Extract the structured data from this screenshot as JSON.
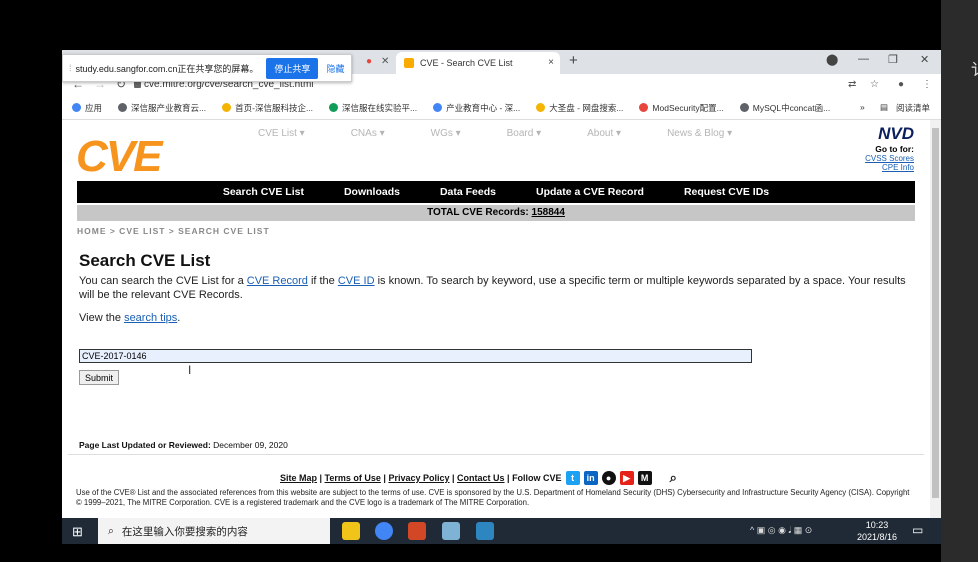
{
  "share_bar": {
    "text": "study.edu.sangfor.com.cn正在共享您的屏幕。",
    "stop": "停止共享",
    "hide": "隐藏"
  },
  "tab": {
    "title": "CVE - Search CVE List",
    "close": "×",
    "new": "+"
  },
  "address": {
    "url": "cve.mitre.org/cve/search_cve_list.html"
  },
  "bookmarks": [
    {
      "label": "应用",
      "color": "#4285f4"
    },
    {
      "label": "深信服产业教育云...",
      "color": "#5f6368"
    },
    {
      "label": "首页-深信服科技企...",
      "color": "#f4b400"
    },
    {
      "label": "深信服在线实验平...",
      "color": "#0f9d58"
    },
    {
      "label": "产业教育中心 - 深...",
      "color": "#4285f4"
    },
    {
      "label": "大圣盘 - 网盘搜索...",
      "color": "#f4b400"
    },
    {
      "label": "ModSecurity配置...",
      "color": "#e8453c"
    },
    {
      "label": "MySQL中concat函...",
      "color": "#5f6368"
    }
  ],
  "bookmarks_more": "»",
  "reading_list": "阅读清单",
  "site": {
    "logo": "CVE",
    "topnav": [
      "CVE List ▾",
      "CNAs ▾",
      "WGs ▾",
      "Board ▾",
      "About ▾",
      "News & Blog ▾"
    ],
    "nvd": {
      "logo": "NVD",
      "goto": "Go to for:",
      "link1": "CVSS Scores",
      "link2": "CPE Info"
    },
    "mainnav": [
      "Search CVE List",
      "Downloads",
      "Data Feeds",
      "Update a CVE Record",
      "Request CVE IDs"
    ],
    "total_label": "TOTAL CVE Records:",
    "total_value": "158844",
    "breadcrumb": "HOME > CVE LIST > SEARCH CVE LIST",
    "heading": "Search CVE List",
    "intro_1": "You can search the CVE List for a ",
    "intro_link1": "CVE Record",
    "intro_2": " if the ",
    "intro_link2": "CVE ID",
    "intro_3": " is known. To search by keyword, use a specific term or multiple keywords separated by a space. Your results will be the relevant CVE Records.",
    "view_1": "View the ",
    "view_link": "search tips",
    "view_2": ".",
    "search_value": "CVE-2017-0146",
    "submit": "Submit",
    "updated_label": "Page Last Updated or Reviewed:",
    "updated_value": "December 09, 2020",
    "foot_sitemap": "Site Map",
    "foot_terms": "Terms of Use",
    "foot_privacy": "Privacy Policy",
    "foot_contact": "Contact Us",
    "foot_follow": "Follow CVE",
    "legal": "Use of the CVE® List and the associated references from this website are subject to the terms of use. CVE is sponsored by the U.S. Department of Homeland Security (DHS) Cybersecurity and Infrastructure Security Agency (CISA). Copyright © 1999–2021, The MITRE Corporation. CVE is a registered trademark and the CVE logo is a trademark of The MITRE Corporation."
  },
  "taskbar": {
    "search_placeholder": "在这里输入你要搜索的内容",
    "time": "10:23",
    "date": "2021/8/16"
  }
}
